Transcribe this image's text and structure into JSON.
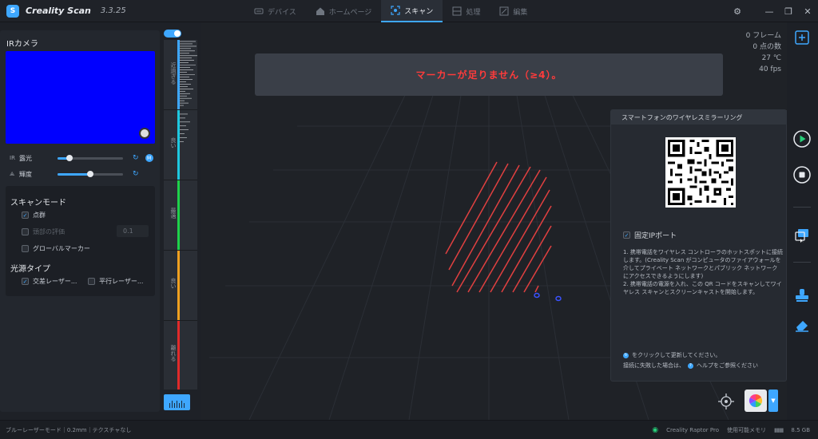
{
  "titlebar": {
    "app_name": "Creality Scan",
    "version": "3.3.25",
    "logo_glyph": "S"
  },
  "nav": {
    "items": [
      {
        "label": "デバイス",
        "icon": "device-icon"
      },
      {
        "label": "ホームページ",
        "icon": "home-icon"
      },
      {
        "label": "スキャン",
        "icon": "scan-icon",
        "active": true
      },
      {
        "label": "処理",
        "icon": "process-icon"
      },
      {
        "label": "編集",
        "icon": "edit-icon"
      }
    ]
  },
  "left_panel": {
    "ir_title": "IRカメラ",
    "exposure": {
      "icon": "IR",
      "label": "露光",
      "value": 0.18
    },
    "brightness": {
      "label": "輝度",
      "value": 0.5
    },
    "auto_badge": "M",
    "scan_mode": {
      "title": "スキャンモード",
      "point_cloud": "点群",
      "point_cloud_checked": true,
      "disabled_option": "頭部の評価",
      "disabled_value": "0.1",
      "global_marker": "グローバルマーカー",
      "global_marker_checked": false
    },
    "light_source": {
      "title": "光源タイプ",
      "cross_laser": "交差レーザー...",
      "cross_laser_checked": true,
      "parallel_laser": "平行レーザー...",
      "parallel_laser_checked": false
    }
  },
  "distance_bar": {
    "segments": [
      {
        "label": "近過ぎる",
        "color": "#3ea7ff"
      },
      {
        "label": "良い",
        "color": "#1ec8e0"
      },
      {
        "label": "最適",
        "color": "#1ed14a"
      },
      {
        "label": "良い",
        "color": "#f0a020"
      },
      {
        "label": "離れる",
        "color": "#e02a2a"
      }
    ]
  },
  "stats": {
    "frames": "0 フレーム",
    "points": "0 点の数",
    "temperature": "27 ℃",
    "fps": "40 fps"
  },
  "warning": "マーカーが足りません（≥4）。",
  "mirror": {
    "title": "スマートフォンのワイヤレスミラーリング",
    "fixed_ip_label": "固定IPポート",
    "fixed_ip_checked": true,
    "instructions": "1. 携帯電話をワイヤレス コントローラのホットスポットに接続します。(Creality Scan がコンピュータのファイアウォールを介してプライベート ネットワークとパブリック ネットワークにアクセスできるようにします)\n2. 携帯電話の電源を入れ、この QR コードをスキャンしてワイヤレス スキャンとスクリーンキャストを開始します。",
    "refresh_note": "をクリックして更新してください。",
    "help_note_prefix": "接続に失敗した場合は、",
    "help_note_suffix": "ヘルプをご参照ください"
  },
  "statusbar": {
    "left": "ブルーレーザーモード｜0.2mm｜テクスチャなし",
    "device": "Creality Raptor Pro",
    "memory_label": "使用可能メモリ",
    "memory_value": "8.5 GB"
  },
  "colors": {
    "accent": "#3ea7ff",
    "warning": "#ff3b3b",
    "play": "#27d07a"
  }
}
